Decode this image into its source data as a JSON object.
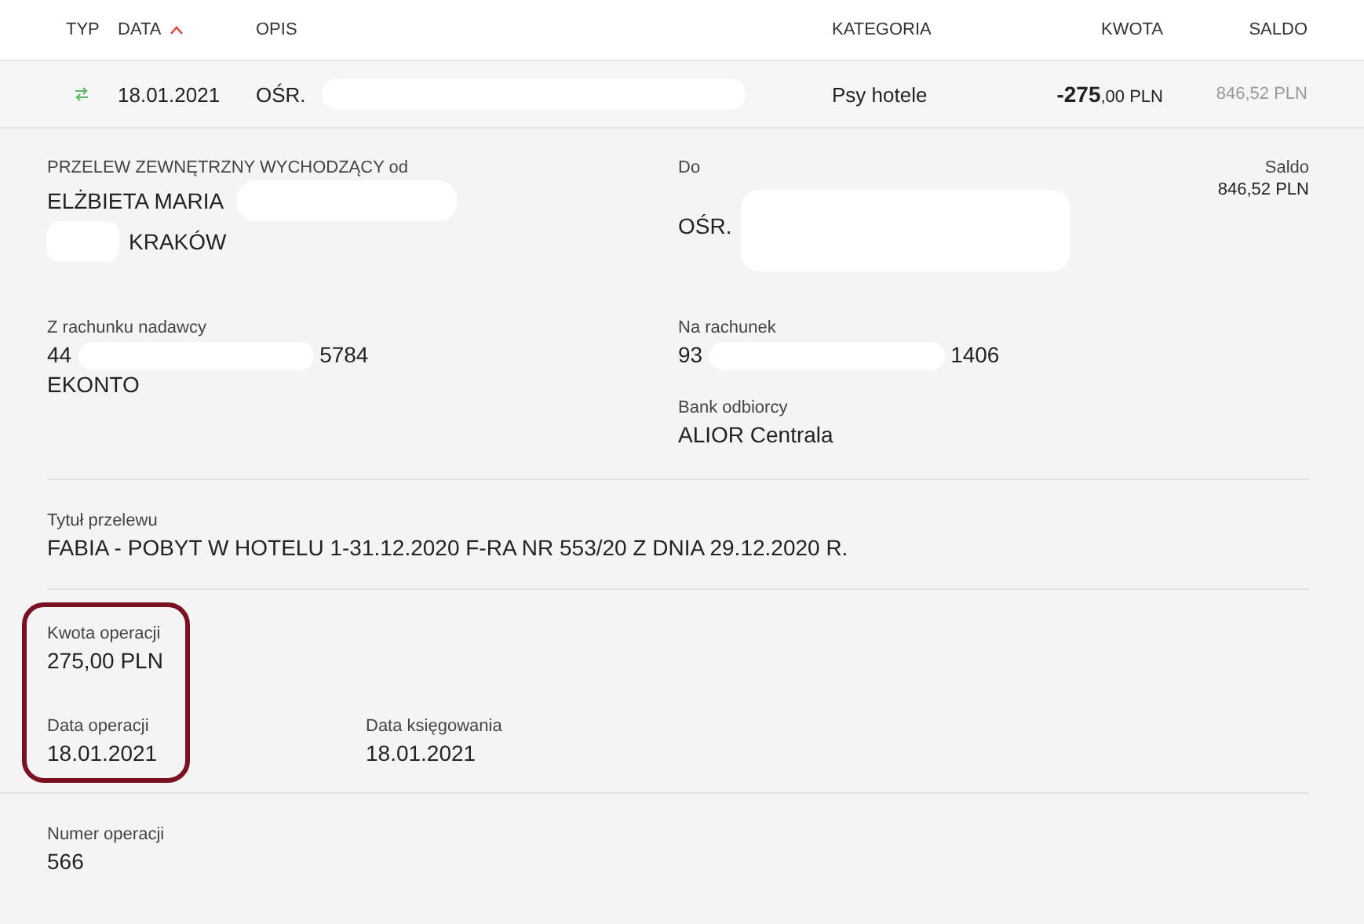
{
  "table": {
    "columns": [
      {
        "label": "TYP",
        "sorted": false
      },
      {
        "label": "DATA",
        "sorted": true
      },
      {
        "label": "OPIS",
        "sorted": false
      },
      {
        "label": "KATEGORIA",
        "sorted": false
      },
      {
        "label": "KWOTA",
        "sorted": false
      },
      {
        "label": "SALDO",
        "sorted": false
      }
    ],
    "rows": [
      {
        "date": "18.01.2021",
        "description": "OŚR.",
        "category": "Psy hotele",
        "amount_main": "-275",
        "amount_rest": ",00 PLN",
        "balance": "846,52 PLN"
      }
    ]
  },
  "details": {
    "sender": {
      "label": "PRZELEW ZEWNĘTRZNY WYCHODZĄCY od",
      "name": "ELŻBIETA MARIA",
      "city": "KRAKÓW"
    },
    "recipient": {
      "label": "Do",
      "name": "OŚR."
    },
    "balance": {
      "label": "Saldo",
      "value": "846,52 PLN"
    },
    "from_account": {
      "label": "Z rachunku nadawcy",
      "start": "44",
      "end": "5784",
      "name": "EKONTO"
    },
    "to_account": {
      "label": "Na rachunek",
      "start": "93",
      "end": "1406"
    },
    "bank": {
      "label": "Bank odbiorcy",
      "value": "ALIOR Centrala"
    },
    "title": {
      "label": "Tytuł przelewu",
      "value": "FABIA - POBYT W HOTELU 1-31.12.2020 F-RA NR 553/20 Z DNIA 29.12.2020 R."
    },
    "amount": {
      "label": "Kwota operacji",
      "value": "275,00 PLN"
    },
    "op_date": {
      "label": "Data operacji",
      "value": "18.01.2021"
    },
    "book_date": {
      "label": "Data księgowania",
      "value": "18.01.2021"
    },
    "number": {
      "label": "Numer operacji",
      "value": "566"
    }
  }
}
